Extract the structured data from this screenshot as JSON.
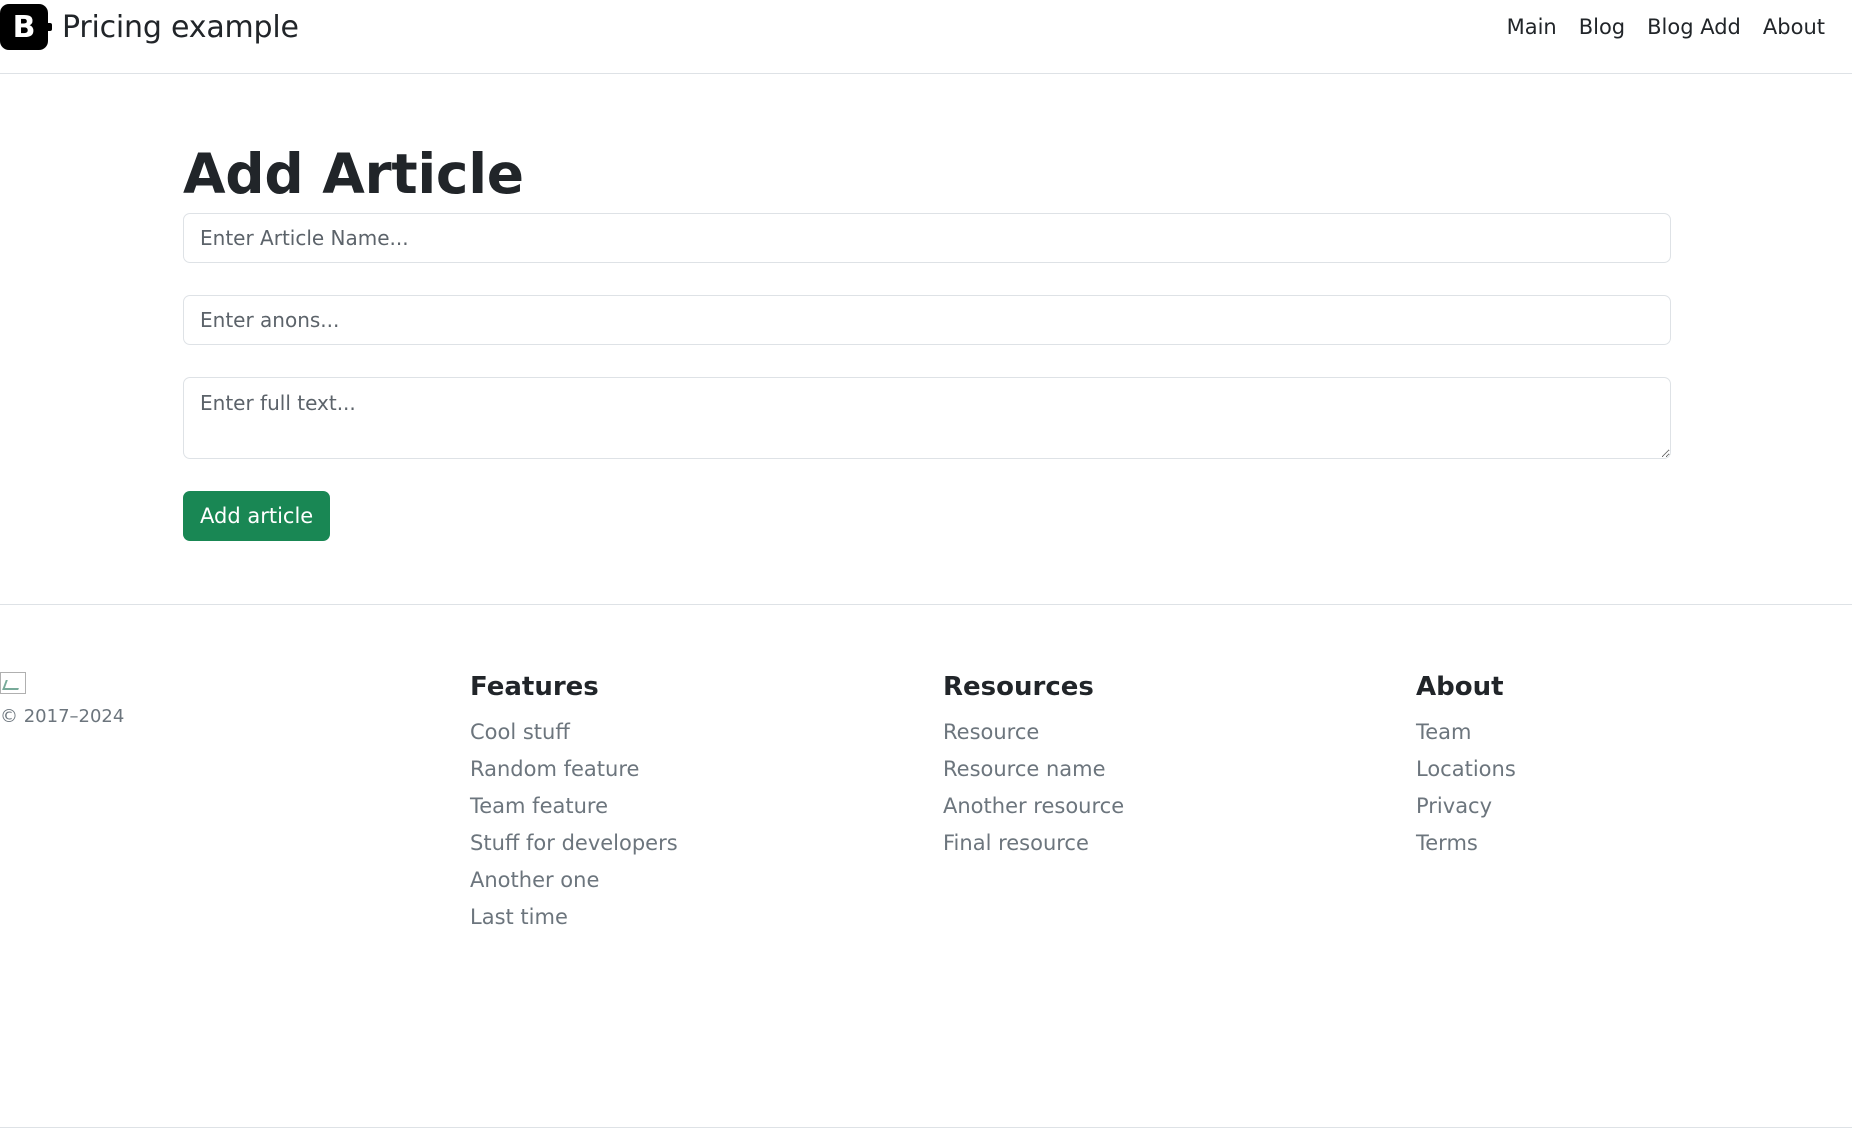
{
  "header": {
    "brand_letter": "B",
    "brand_title": "Pricing example",
    "nav": [
      {
        "label": "Main"
      },
      {
        "label": "Blog"
      },
      {
        "label": "Blog Add"
      },
      {
        "label": "About"
      }
    ]
  },
  "main": {
    "title": "Add Article",
    "name_placeholder": "Enter Article Name...",
    "anons_placeholder": "Enter anons...",
    "text_placeholder": "Enter full text...",
    "submit_label": "Add article",
    "accent_color": "#198754"
  },
  "footer": {
    "copyright": "© 2017–2024",
    "columns": [
      {
        "heading": "Features",
        "links": [
          "Cool stuff",
          "Random feature",
          "Team feature",
          "Stuff for developers",
          "Another one",
          "Last time"
        ]
      },
      {
        "heading": "Resources",
        "links": [
          "Resource",
          "Resource name",
          "Another resource",
          "Final resource"
        ]
      },
      {
        "heading": "About",
        "links": [
          "Team",
          "Locations",
          "Privacy",
          "Terms"
        ]
      }
    ]
  }
}
